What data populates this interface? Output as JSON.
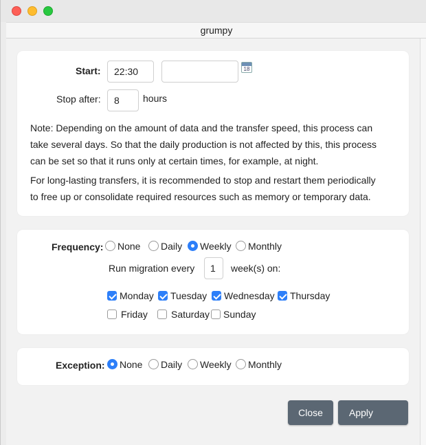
{
  "window": {
    "title": "grumpy"
  },
  "schedule": {
    "start_label": "Start:",
    "start_time": "22:30",
    "start_date": "",
    "calendar_icon": "calendar-icon",
    "calendar_day": "18",
    "stop_label": "Stop after:",
    "stop_value": "8",
    "stop_unit": "hours",
    "note1": [
      "Note: Depending on the amount of data and the transfer speed, this process can",
      "take several days. So that the daily production is not affected by this, this process",
      "can be set so that it runs only at certain times, for example, at night."
    ],
    "note2": [
      "For long-lasting transfers, it is recommended to stop and restart them periodically",
      "to free up or consolidate required resources such as memory or temporary data."
    ]
  },
  "frequency": {
    "label": "Frequency:",
    "options": [
      "None",
      "Daily",
      "Weekly",
      "Monthly"
    ],
    "selected": "Weekly",
    "run_every_label": "Run migration every",
    "run_every_value": "1",
    "run_every_unit": "week(s) on:",
    "days": [
      {
        "label": "Monday",
        "checked": true
      },
      {
        "label": "Tuesday",
        "checked": true
      },
      {
        "label": "Wednesday",
        "checked": true
      },
      {
        "label": "Thursday",
        "checked": true
      },
      {
        "label": "Friday",
        "checked": false
      },
      {
        "label": "Saturday",
        "checked": false
      },
      {
        "label": "Sunday",
        "checked": false
      }
    ]
  },
  "exception": {
    "label": "Exception:",
    "options": [
      "None",
      "Daily",
      "Weekly",
      "Monthly"
    ],
    "selected": "None"
  },
  "buttons": {
    "close": "Close",
    "apply": "Apply"
  },
  "colors": {
    "accent": "#2d7ff9",
    "button": "#5b6773"
  }
}
